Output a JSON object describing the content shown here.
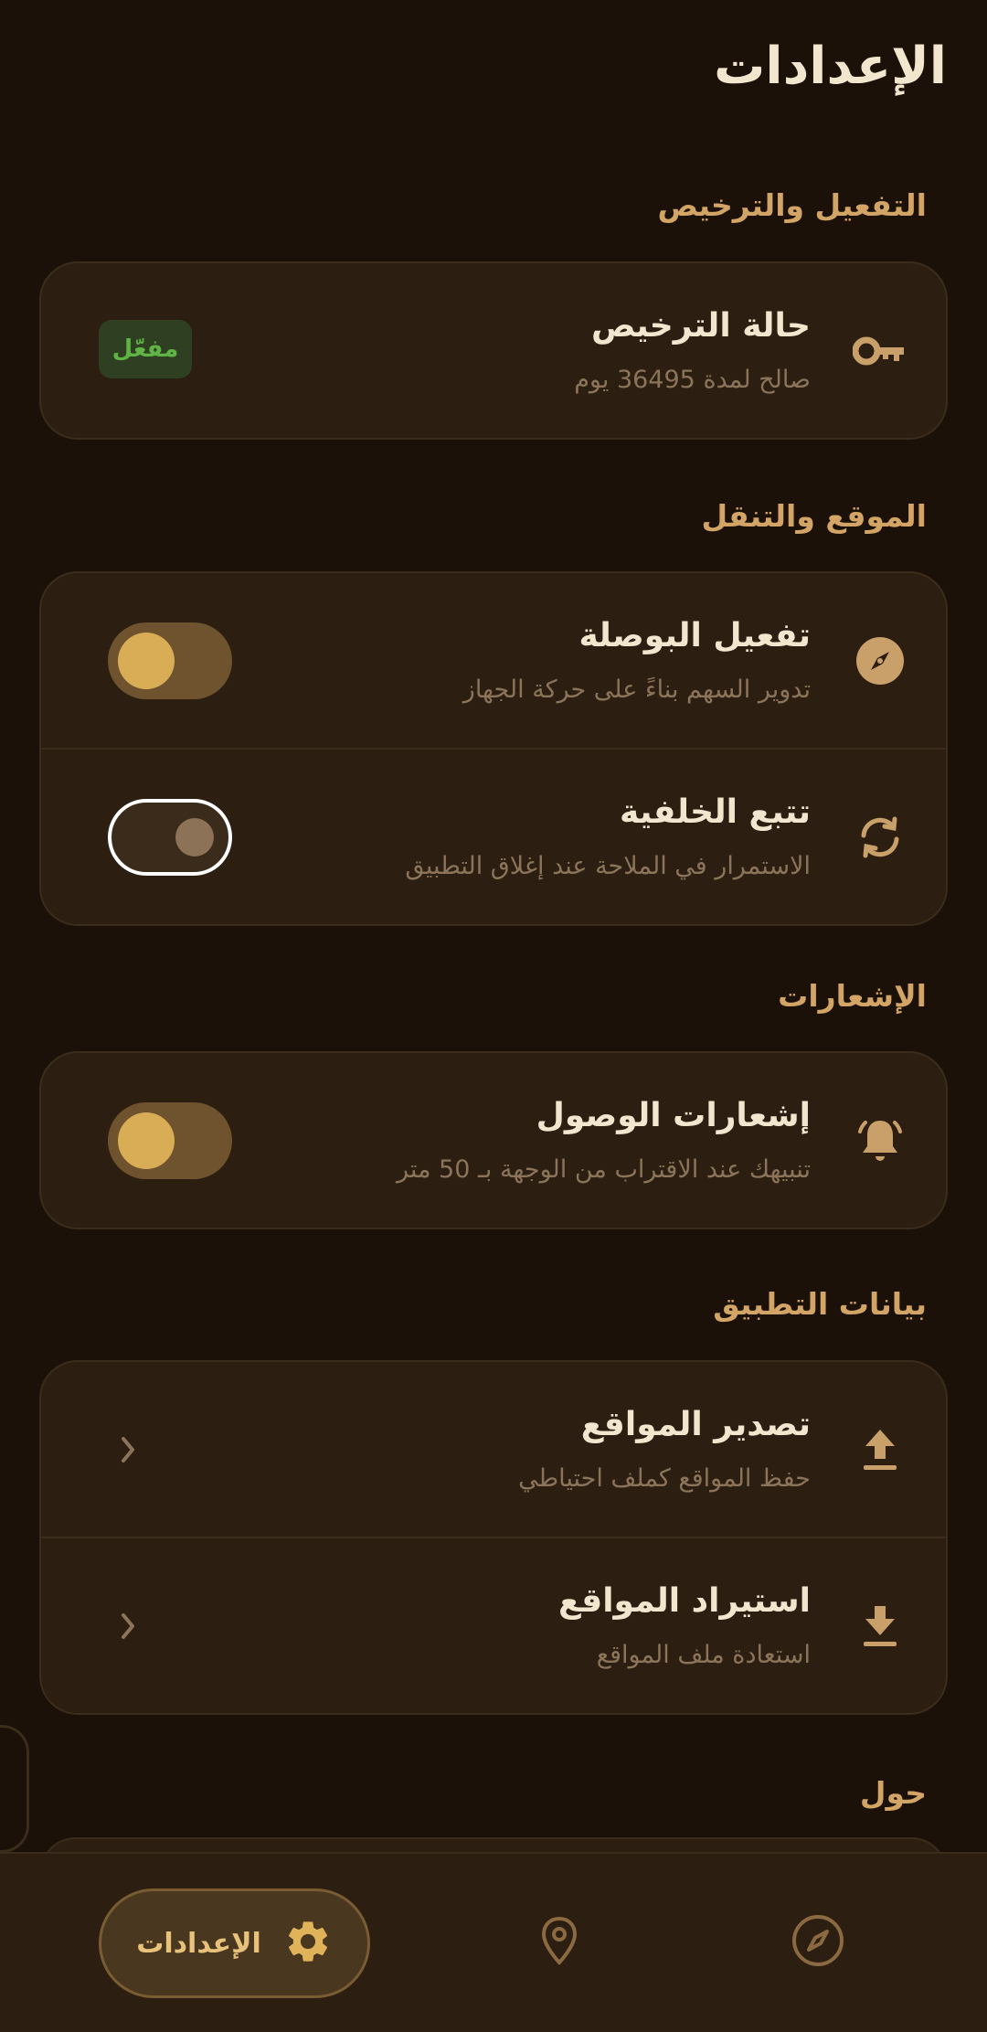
{
  "header": {
    "title": "الإعدادات"
  },
  "sections": {
    "activation": {
      "title": "التفعيل والترخيص",
      "license": {
        "title": "حالة الترخيص",
        "subtitle": "صالح لمدة 36495 يوم",
        "badge": "مفعّل",
        "icon": "key-icon"
      }
    },
    "location": {
      "title": "الموقع والتنقل",
      "compass": {
        "title": "تفعيل البوصلة",
        "subtitle": "تدوير السهم بناءً على حركة الجهاز",
        "icon": "compass-icon",
        "enabled": true
      },
      "background": {
        "title": "تتبع الخلفية",
        "subtitle": "الاستمرار في الملاحة عند إغلاق التطبيق",
        "icon": "sync-icon",
        "enabled": false
      }
    },
    "notifications": {
      "title": "الإشعارات",
      "arrival": {
        "title": "إشعارات الوصول",
        "subtitle": "تنبيهك عند الاقتراب من الوجهة بـ 50 متر",
        "icon": "bell-icon",
        "enabled": true
      }
    },
    "app_data": {
      "title": "بيانات التطبيق",
      "export": {
        "title": "تصدير المواقع",
        "subtitle": "حفظ المواقع كملف احتياطي",
        "icon": "upload-icon"
      },
      "import": {
        "title": "استيراد المواقع",
        "subtitle": "استعادة ملف المواقع",
        "icon": "download-icon"
      }
    },
    "about": {
      "title": "حول"
    }
  },
  "bottom_nav": {
    "settings_label": "الإعدادات",
    "settings_icon": "gear-icon",
    "locations_icon": "map-pin-icon",
    "compass_icon": "compass-icon"
  },
  "colors": {
    "background": "#1b1109",
    "card": "#2c1f12",
    "accent": "#d8ad56",
    "section_title": "#d2a466",
    "badge_text": "#5fb445"
  }
}
